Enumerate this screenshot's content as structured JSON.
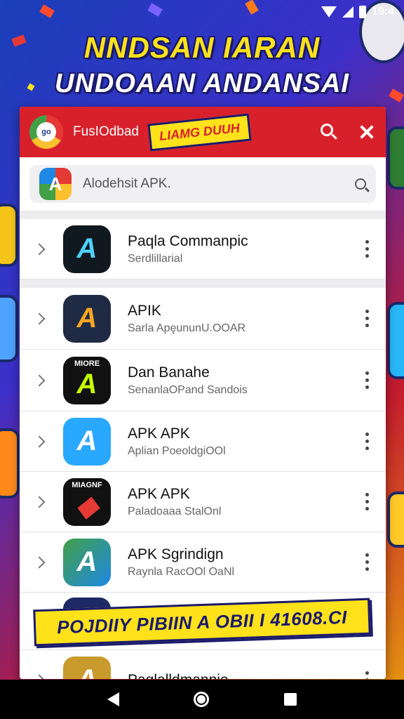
{
  "status_bar": {
    "time": "19:4"
  },
  "headline": {
    "line1": "NNDSAN IARAN",
    "line2": "UNDOAAN ANDANSAI"
  },
  "app_header": {
    "title": "FusIOdbad",
    "promo_label": "LIAMG DUUH",
    "logo_text": "go",
    "search_icon": "search-icon",
    "close_icon": "close-icon"
  },
  "search": {
    "placeholder": "Alodehsit APK."
  },
  "items": [
    {
      "name": "Paqla Commanpic",
      "sub": "Serdlillarial",
      "badge": ""
    },
    {
      "name": "APIK",
      "sub": "Sarla ApęununU.OOAR",
      "badge": ""
    },
    {
      "name": "Dan Banahe",
      "sub": "SenanlaOPand Sandois",
      "badge": "MIORE"
    },
    {
      "name": "APK APK",
      "sub": "Aplian PoeoldgiOOl",
      "badge": ""
    },
    {
      "name": "APK  APK",
      "sub": "Paladoaaa StalOnl",
      "badge": "MIAGNF"
    },
    {
      "name": "APK Sgrindign",
      "sub": "Raynla RacOOl OaNl",
      "badge": ""
    },
    {
      "name": "Paqlalldmanpie",
      "sub": "",
      "badge": ""
    }
  ],
  "promo_ribbon": "POJDIIY PIBIIN A OBII I 41608.CI",
  "colors": {
    "header_red": "#d8202b",
    "accent_yellow": "#ffe21a",
    "navy": "#1a1a6e"
  },
  "nav": {
    "back_icon": "back-icon",
    "home_icon": "home-icon",
    "recent_icon": "recent-apps-icon"
  }
}
